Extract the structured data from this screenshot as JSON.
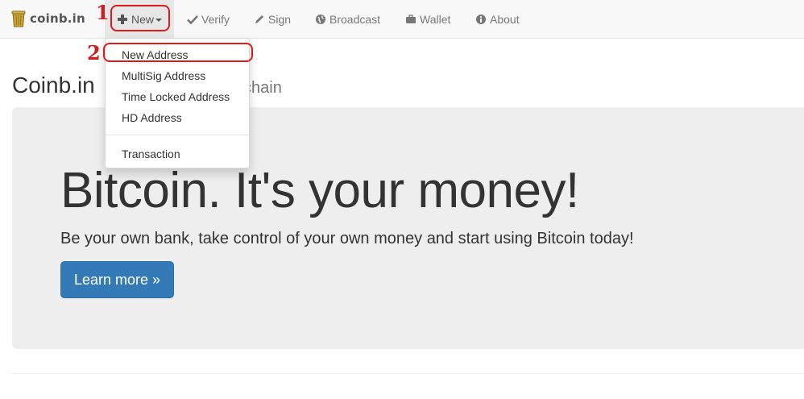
{
  "navbar": {
    "brand": "coinb.in",
    "items": [
      {
        "label": "New",
        "icon": "plus-icon"
      },
      {
        "label": "Verify",
        "icon": "check-icon"
      },
      {
        "label": "Sign",
        "icon": "pencil-icon"
      },
      {
        "label": "Broadcast",
        "icon": "globe-icon"
      },
      {
        "label": "Wallet",
        "icon": "briefcase-icon"
      },
      {
        "label": "About",
        "icon": "info-icon"
      }
    ]
  },
  "dropdown": {
    "items": [
      {
        "label": "New Address"
      },
      {
        "label": "MultiSig Address"
      },
      {
        "label": "Time Locked Address"
      },
      {
        "label": "HD Address"
      },
      {
        "label": "Transaction"
      }
    ]
  },
  "annotations": {
    "step1": "1",
    "step2": "2",
    "color": "#e01a1a"
  },
  "page": {
    "title": "Coinb.in",
    "subtitle_visible": "ckchain"
  },
  "jumbotron": {
    "title": "Bitcoin. It's your money!",
    "lead": "Be your own bank, take control of your own money and start using Bitcoin today!",
    "button": "Learn more »"
  },
  "colors": {
    "primary_button": "#337ab7",
    "navbar_bg": "#f8f8f8",
    "jumbotron_bg": "#eeeeee"
  }
}
